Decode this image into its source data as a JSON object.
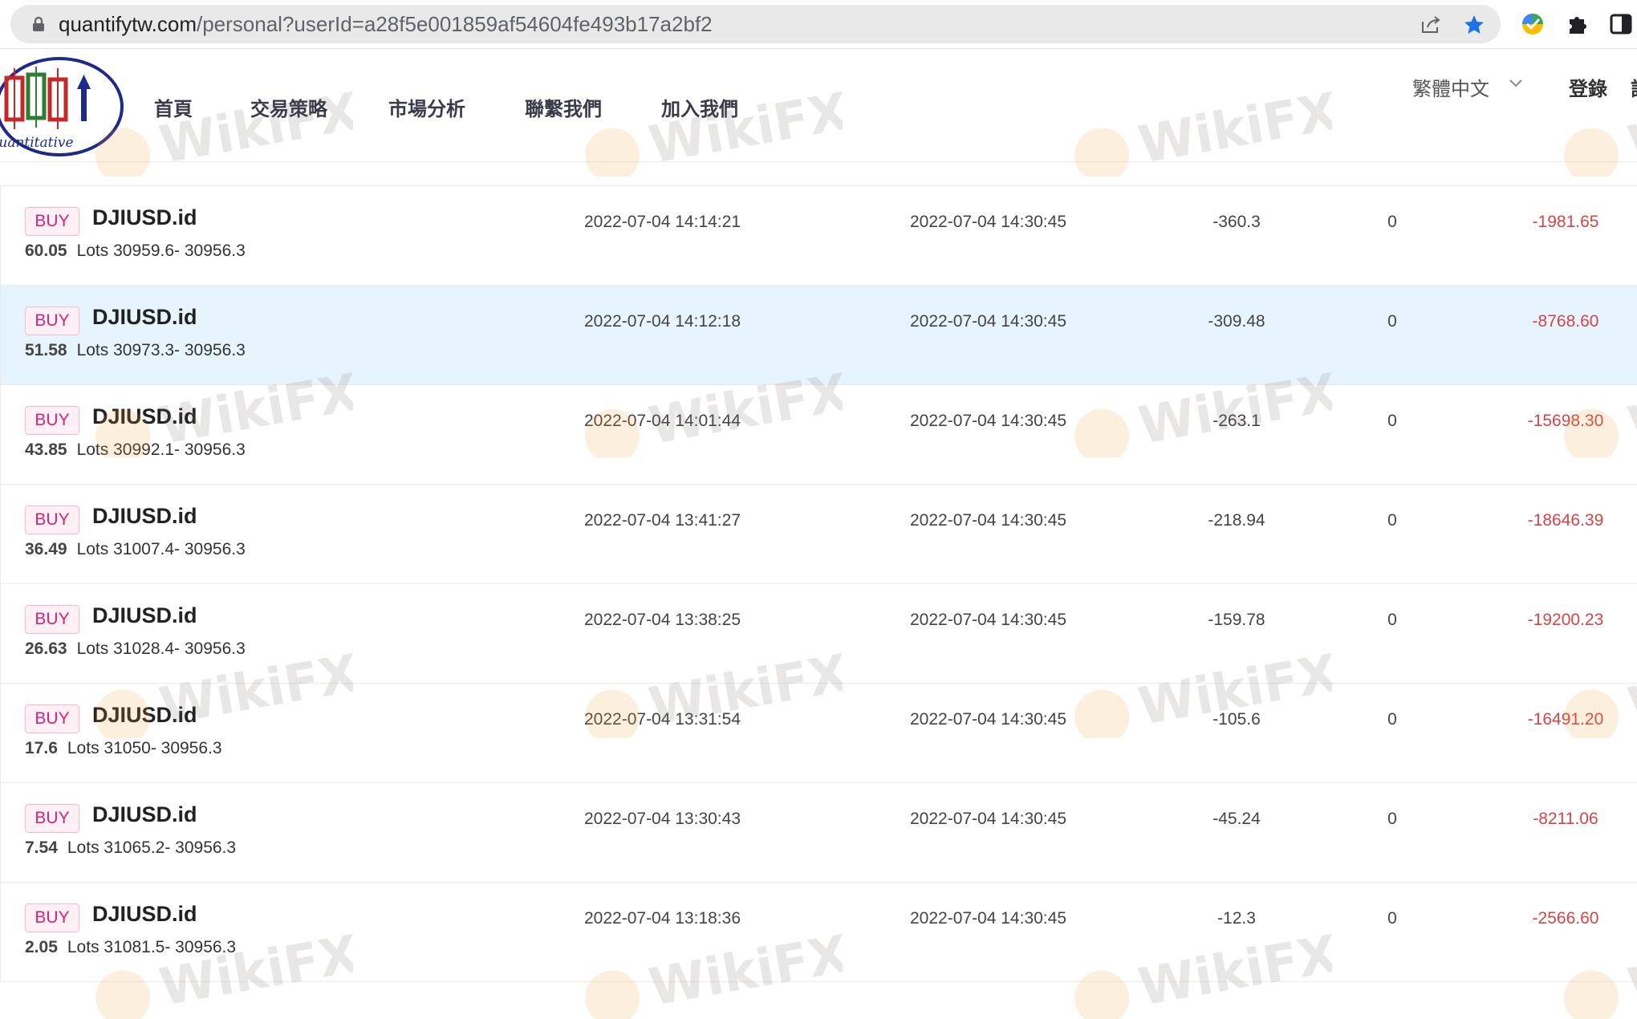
{
  "browser": {
    "url_host": "quantifytw.com",
    "url_path": "/personal?userId=a28f5e001859af54604fe493b17a2bf2"
  },
  "logo": {
    "text": "Quantitative"
  },
  "nav": [
    {
      "label": "首頁"
    },
    {
      "label": "交易策略"
    },
    {
      "label": "市場分析"
    },
    {
      "label": "聯繫我們"
    },
    {
      "label": "加入我們"
    }
  ],
  "header": {
    "language": "繁體中文",
    "login": "登錄",
    "register": "註"
  },
  "watermark": {
    "text": "WikiFX"
  },
  "trades": [
    {
      "side": "BUY",
      "symbol": "DJIUSD.id",
      "lots": "60.05",
      "lots_label": "Lots",
      "prices": "30959.6- 30956.3",
      "open_time": "2022-07-04 14:14:21",
      "close_time": "2022-07-04 14:30:45",
      "points": "-360.3",
      "swap": "0",
      "profit": "-1981.65"
    },
    {
      "side": "BUY",
      "symbol": "DJIUSD.id",
      "lots": "51.58",
      "lots_label": "Lots",
      "prices": "30973.3- 30956.3",
      "open_time": "2022-07-04 14:12:18",
      "close_time": "2022-07-04 14:30:45",
      "points": "-309.48",
      "swap": "0",
      "profit": "-8768.60"
    },
    {
      "side": "BUY",
      "symbol": "DJIUSD.id",
      "lots": "43.85",
      "lots_label": "Lots",
      "prices": "30992.1- 30956.3",
      "open_time": "2022-07-04 14:01:44",
      "close_time": "2022-07-04 14:30:45",
      "points": "-263.1",
      "swap": "0",
      "profit": "-15698.30"
    },
    {
      "side": "BUY",
      "symbol": "DJIUSD.id",
      "lots": "36.49",
      "lots_label": "Lots",
      "prices": "31007.4- 30956.3",
      "open_time": "2022-07-04 13:41:27",
      "close_time": "2022-07-04 14:30:45",
      "points": "-218.94",
      "swap": "0",
      "profit": "-18646.39"
    },
    {
      "side": "BUY",
      "symbol": "DJIUSD.id",
      "lots": "26.63",
      "lots_label": "Lots",
      "prices": "31028.4- 30956.3",
      "open_time": "2022-07-04 13:38:25",
      "close_time": "2022-07-04 14:30:45",
      "points": "-159.78",
      "swap": "0",
      "profit": "-19200.23"
    },
    {
      "side": "BUY",
      "symbol": "DJIUSD.id",
      "lots": "17.6",
      "lots_label": "Lots",
      "prices": "31050- 30956.3",
      "open_time": "2022-07-04 13:31:54",
      "close_time": "2022-07-04 14:30:45",
      "points": "-105.6",
      "swap": "0",
      "profit": "-16491.20"
    },
    {
      "side": "BUY",
      "symbol": "DJIUSD.id",
      "lots": "7.54",
      "lots_label": "Lots",
      "prices": "31065.2- 30956.3",
      "open_time": "2022-07-04 13:30:43",
      "close_time": "2022-07-04 14:30:45",
      "points": "-45.24",
      "swap": "0",
      "profit": "-8211.06"
    },
    {
      "side": "BUY",
      "symbol": "DJIUSD.id",
      "lots": "2.05",
      "lots_label": "Lots",
      "prices": "31081.5- 30956.3",
      "open_time": "2022-07-04 13:18:36",
      "close_time": "2022-07-04 14:30:45",
      "points": "-12.3",
      "swap": "0",
      "profit": "-2566.60"
    }
  ]
}
